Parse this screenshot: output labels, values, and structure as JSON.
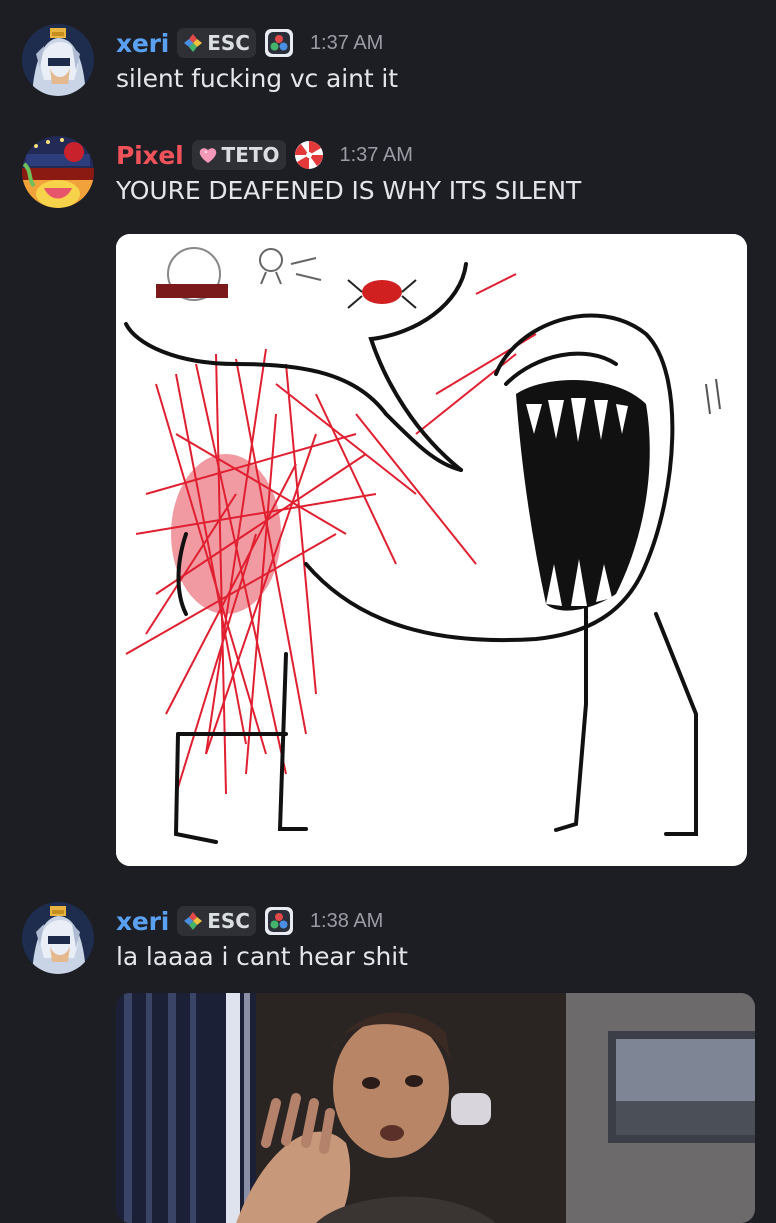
{
  "messages": [
    {
      "username": "xeri",
      "username_color": "#5aa1f2",
      "tag": "ESC",
      "time": "1:37 AM",
      "text": "silent fucking vc aint it"
    },
    {
      "username": "Pixel",
      "username_color": "#f0525a",
      "tag": "TETO",
      "time": "1:37 AM",
      "text": "YOURE DEAFENED IS WHY ITS SILENT",
      "attachment_icon": "stick-figure-drawing-image"
    },
    {
      "username": "xeri",
      "username_color": "#5aa1f2",
      "tag": "ESC",
      "time": "1:38 AM",
      "text": "la laaaa i cant hear shit",
      "attachment_icon": "man-covering-ears-gif"
    }
  ]
}
